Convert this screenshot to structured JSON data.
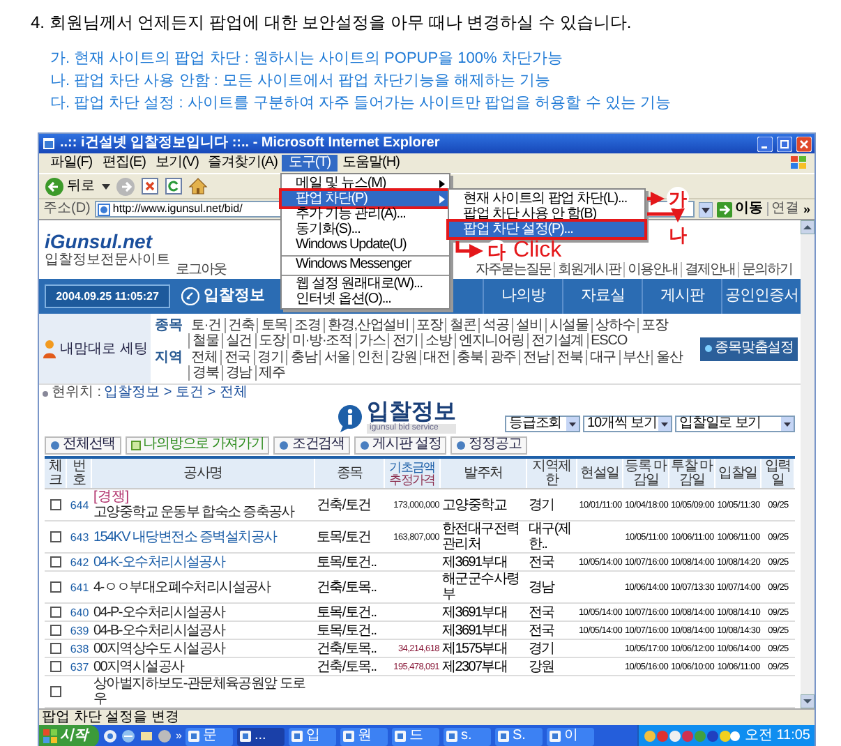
{
  "heading": "4. 회원님께서 언제든지 팝업에 대한 보안설정을 아무 때나 변경하실 수 있습니다.",
  "notes": [
    "가. 현재 사이트의 팝업 차단 : 원하시는 사이트의 POPUP을 100% 차단가능",
    "나. 팝업 차단 사용 안함 : 모든 사이트에서 팝업 차단기능을 해제하는 기능",
    "다. 팝업 차단 설정 : 사이트를 구분하여 자주 들어가는 사이트만 팝업을 허용할 수 있는 기능"
  ],
  "window": {
    "title": "..:: i건설넷 입찰정보입니다 ::.. - Microsoft Internet Explorer"
  },
  "menu_bar": [
    {
      "label": "파일(F)",
      "selected": false
    },
    {
      "label": "편집(E)",
      "selected": false
    },
    {
      "label": "보기(V)",
      "selected": false
    },
    {
      "label": "즐겨찾기(A)",
      "selected": false
    },
    {
      "label": "도구(T)",
      "selected": true
    },
    {
      "label": "도움말(H)",
      "selected": false
    }
  ],
  "toolbar": {
    "back": "뒤로"
  },
  "address_bar": {
    "label": "주소(D)",
    "value": "http://www.igunsul.net/bid/",
    "go": "이동",
    "links": "연결",
    "more": "»"
  },
  "tools_menu": [
    {
      "label": "메일 및 뉴스(M)",
      "submenu": true,
      "selected": false,
      "outlined": false
    },
    {
      "label": "팝업 차단(P)",
      "submenu": true,
      "selected": true,
      "outlined": true
    },
    {
      "label": "추가 기능 관리(A)...",
      "submenu": false,
      "selected": false,
      "outlined": false
    },
    {
      "label": "동기화(S)...",
      "submenu": false,
      "selected": false,
      "outlined": false
    },
    {
      "label": "Windows Update(U)",
      "submenu": false,
      "selected": false,
      "outlined": false,
      "separator_after": true
    },
    {
      "label": "Windows Messenger",
      "submenu": false,
      "selected": false,
      "outlined": false,
      "separator_after": true
    },
    {
      "label": "웹 설정 원래대로(W)...",
      "submenu": false,
      "selected": false,
      "outlined": false
    },
    {
      "label": "인터넷 옵션(O)...",
      "submenu": false,
      "selected": false,
      "outlined": false
    }
  ],
  "popup_submenu": [
    {
      "label": "현재 사이트의 팝업 차단(L)...",
      "selected": false,
      "outlined": false
    },
    {
      "label": "팝업 차단 사용 안 함(B)",
      "selected": false,
      "outlined": false
    },
    {
      "label": "팝업 차단 설정(P)...",
      "selected": true,
      "outlined": true
    }
  ],
  "callouts": [
    "가",
    "나",
    "다"
  ],
  "click_label": "Click",
  "site": {
    "logo": "iGunsul.net",
    "tagline": "입찰정보전문사이트",
    "top_links_left": [
      "로그아웃"
    ],
    "top_links_right": [
      "자주묻는질문",
      "회원게시판",
      "이용안내",
      "결제안내",
      "문의하기"
    ],
    "clock": "2004.09.25 11:05:27",
    "nav_left": "입찰정보",
    "nav": [
      "나의방",
      "자료실",
      "게시판",
      "공인인증서"
    ],
    "my_settings": "내맘대로 세팅",
    "category_label": "종목",
    "categories": [
      "토·건",
      "건축",
      "토목",
      "조경",
      "환경,산업설비",
      "포장",
      "철콘",
      "석공",
      "설비",
      "시설물",
      "상하수",
      "포장",
      "철물",
      "실건",
      "도장",
      "미·방·조적",
      "가스",
      "전기",
      "소방",
      "엔지니어링",
      "전기설계",
      "ESCO"
    ],
    "region_label": "지역",
    "regions": [
      "전체",
      "전국",
      "경기",
      "충남",
      "서울",
      "인천",
      "강원",
      "대전",
      "충북",
      "광주",
      "전남",
      "전북",
      "대구",
      "부산",
      "울산",
      "경북",
      "경남",
      "제주"
    ],
    "custom_button": "종목맞춤설정",
    "breadcrumb_label": "현위치 :",
    "breadcrumb": "입찰정보 > 토건 > 전체",
    "page_title": "입찰정보",
    "page_subtitle": "igunsul bid service",
    "selects": [
      "등급조회",
      "10개씩 보기",
      "입찰일로 보기"
    ],
    "actions": [
      "전체선택",
      "나의방으로 가져가기",
      "조건검색",
      "게시판 설정",
      "정정공고"
    ]
  },
  "table": {
    "columns": [
      "체크",
      "번호",
      "공사명",
      "종목",
      "기초금액",
      "추정가격",
      "발주처",
      "지역제한",
      "현설일",
      "등록 마감일",
      "투찰 마감일",
      "입찰일",
      "입력일"
    ],
    "rows": [
      {
        "checked": false,
        "no": "644",
        "tag": "[경쟁]",
        "name": "고양중학교 운동부 합숙소 증축공사",
        "linked": false,
        "type": "건축/토건",
        "amount": "173,000,000",
        "estimated": false,
        "orderer": "고양중학교",
        "region": "경기",
        "site": "10/01/11:00",
        "reg": "10/04/18:00",
        "bid": "10/05/09:00",
        "open": "10/05/11:30",
        "input": "09/25"
      },
      {
        "checked": false,
        "no": "643",
        "name": "154KV 내당변전소 증벽설치공사",
        "linked": true,
        "type": "토목/토건",
        "amount": "163,807,000",
        "estimated": false,
        "orderer": "한전대구전력관리처",
        "region": "대구(제한..",
        "reg": "10/05/11:00",
        "bid": "10/06/11:00",
        "open": "10/06/11:00",
        "input": "09/25"
      },
      {
        "checked": false,
        "no": "642",
        "name": "04-K-오수처리시설공사",
        "linked": true,
        "type": "토목/토건..",
        "orderer": "제3691부대",
        "region": "전국",
        "site": "10/05/14:00",
        "reg": "10/07/16:00",
        "bid": "10/08/14:00",
        "open": "10/08/14:20",
        "input": "09/25"
      },
      {
        "checked": false,
        "no": "641",
        "name": "4-ㅇㅇ부대오폐수처리시설공사",
        "linked": false,
        "type": "건축/토목..",
        "orderer": "해군군수사령부",
        "region": "경남",
        "reg": "10/06/14:00",
        "bid": "10/07/13:30",
        "open": "10/07/14:00",
        "input": "09/25"
      },
      {
        "checked": false,
        "no": "640",
        "name": "04-P-오수처리시설공사",
        "linked": false,
        "type": "토목/토건..",
        "orderer": "제3691부대",
        "region": "전국",
        "site": "10/05/14:00",
        "reg": "10/07/16:00",
        "bid": "10/08/14:00",
        "open": "10/08/14:10",
        "input": "09/25"
      },
      {
        "checked": false,
        "no": "639",
        "name": "04-B-오수처리시설공사",
        "linked": false,
        "type": "토목/토건..",
        "orderer": "제3691부대",
        "region": "전국",
        "site": "10/05/14:00",
        "reg": "10/07/16:00",
        "bid": "10/08/14:00",
        "open": "10/08/14:30",
        "input": "09/25"
      },
      {
        "checked": false,
        "no": "638",
        "name": "00지역상수도 시설공사",
        "linked": false,
        "type": "건축/토목..",
        "amount": "34,214,618",
        "estimated": true,
        "orderer": "제1575부대",
        "region": "경기",
        "reg": "10/05/17:00",
        "bid": "10/06/12:00",
        "open": "10/06/14:00",
        "input": "09/25"
      },
      {
        "checked": false,
        "no": "637",
        "name": "00지역시설공사",
        "linked": false,
        "type": "건축/토목..",
        "amount": "195,478,091",
        "estimated": true,
        "orderer": "제2307부대",
        "region": "강원",
        "reg": "10/05/16:00",
        "bid": "10/06/10:00",
        "open": "10/06/11:00",
        "input": "09/25"
      },
      {
        "checked": false,
        "name": "상아벌지하보도-관문체육공원앞 도로우",
        "linked": false
      }
    ]
  },
  "status_bar": "팝업 차단 설정을 변경",
  "taskbar": {
    "start": "시작",
    "quick_more": "»",
    "tasks": [
      {
        "label": "문",
        "selected": false
      },
      {
        "label": "...",
        "selected": true
      },
      {
        "label": "입",
        "selected": false
      },
      {
        "label": "원",
        "selected": false
      },
      {
        "label": "드",
        "selected": false
      },
      {
        "label": "s.",
        "selected": false
      },
      {
        "label": "S.",
        "selected": false
      },
      {
        "label": "이",
        "selected": false
      }
    ],
    "clock": "오전 11:05"
  }
}
